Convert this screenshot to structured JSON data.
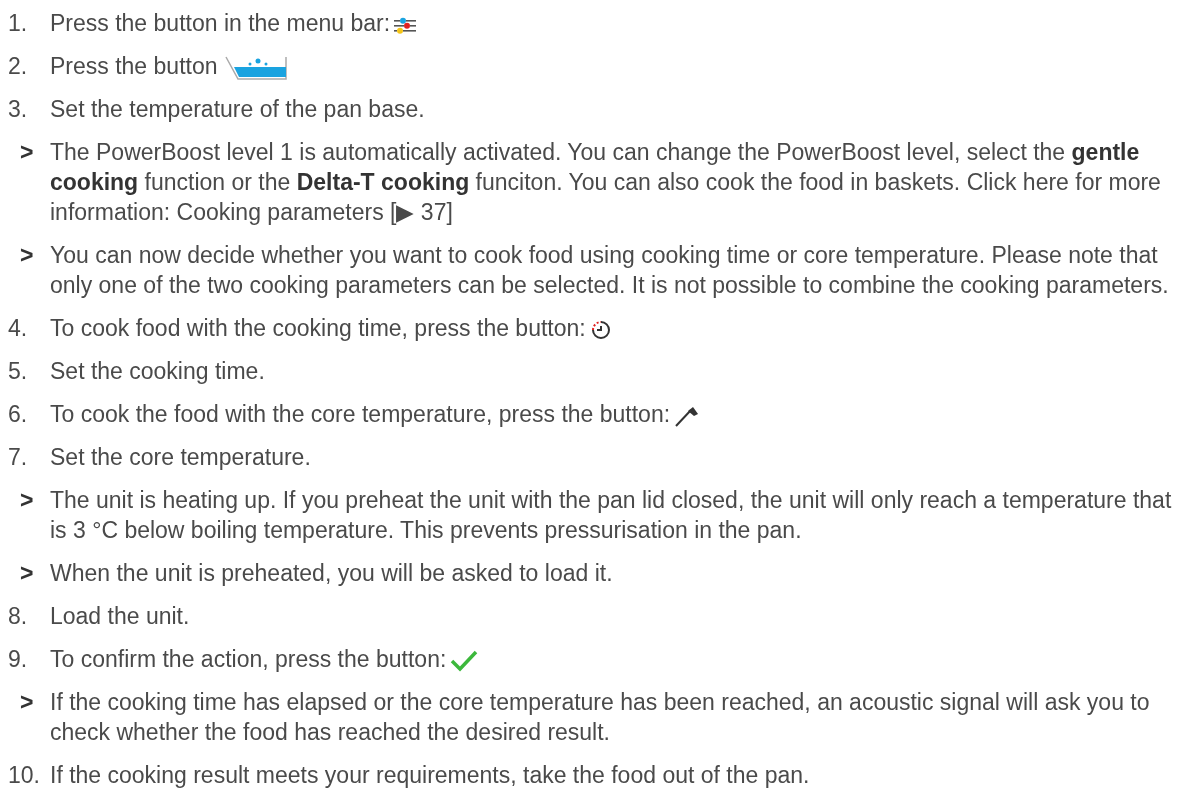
{
  "steps": [
    {
      "kind": "step",
      "number": "1.",
      "text": "Press the button in the menu bar:"
    },
    {
      "kind": "step",
      "number": "2.",
      "text": "Press the button"
    },
    {
      "kind": "step",
      "number": "3.",
      "text": "Set the temperature of the pan base."
    },
    {
      "kind": "result",
      "marker": ">",
      "text": "The PowerBoost level 1 is automatically activated. You can change the PowerBoost level, select the **gentle cooking** function or the **Delta-T cooking** funciton. You can also cook the food in baskets. Click here for more information:",
      "link": "Cooking parameters [▶ 37]"
    },
    {
      "kind": "result",
      "marker": ">",
      "text": "You can now decide whether you want to cook food using cooking time or core temperature. Please note that only one of the two cooking parameters can be selected. It is not possible to combine the cooking parameters."
    },
    {
      "kind": "step",
      "number": "4.",
      "text": "To cook food with the cooking time, press the button:"
    },
    {
      "kind": "step",
      "number": "5.",
      "text": "Set the cooking time."
    },
    {
      "kind": "step",
      "number": "6.",
      "text": "To cook the food with the core temperature, press the button:"
    },
    {
      "kind": "step",
      "number": "7.",
      "text": "Set the core temperature."
    },
    {
      "kind": "result",
      "marker": ">",
      "text": "The unit is heating up. If you preheat the unit with the pan lid closed, the unit will only reach a temperature that is 3 °C below boiling temperature. This prevents pressurisation in the pan."
    },
    {
      "kind": "result",
      "marker": ">",
      "text": "When the unit is preheated, you will be asked to load it."
    },
    {
      "kind": "step",
      "number": "8.",
      "text": "Load the unit."
    },
    {
      "kind": "step",
      "number": "9.",
      "text": "To confirm the action, press the button:"
    },
    {
      "kind": "result",
      "marker": ">",
      "text": "If the cooking time has elapsed or the core temperature has been reached, an acoustic signal will ask you to check whether the food has reached the desired result."
    },
    {
      "kind": "step",
      "number": "10.",
      "text": "If the cooking result meets your requirements, take the food out of the pan."
    }
  ]
}
